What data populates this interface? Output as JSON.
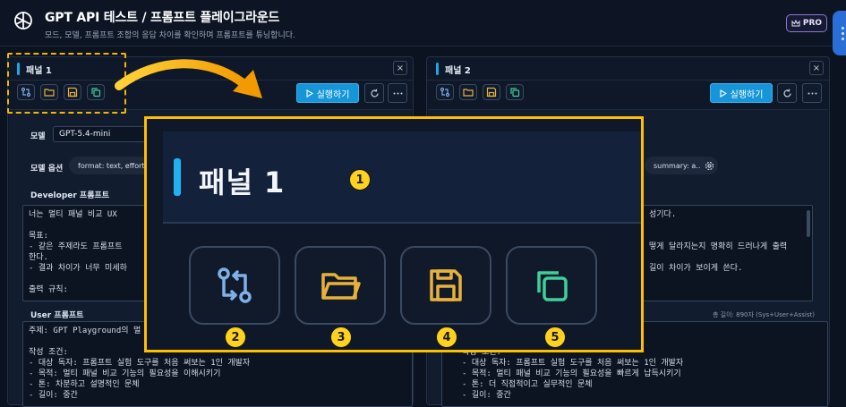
{
  "app": {
    "title": "GPT API 테스트 / 프롬프트 플레이그라운드",
    "subtitle": "모드, 모델, 프롬프트 조합의 응답 차이를 확인하며 프롬프트를 튜닝합니다.",
    "pro_label": "PRO"
  },
  "panels": [
    {
      "title": "패널 1",
      "run_label": "실행하기",
      "close": "×",
      "model_label": "모델",
      "model_value": "GPT-5.4-mini",
      "options_label": "모델 옵션",
      "options_value": "format: text, effort:",
      "developer_label": "Developer 프롬프트",
      "developer_text": "너는 멀티 패널 비교 UX\n\n목표:\n- 같은 주제라도 프롬프트\n한다.\n- 결과 차이가 너무 미세하\n\n출력 규칙:",
      "user_label": "User 프롬프트",
      "user_text": "주제: GPT Playground의 멀\n\n작성 조건:\n- 대상 독자: 프롬프트 실험 도구를 처음 써보는 1인 개발자\n- 목적: 멀티 패널 비교 기능의 필요성을 이해시키기\n- 톤: 차분하고 설명적인 문체\n- 길이: 중간"
    },
    {
      "title": "패널 2",
      "run_label": "실행하기",
      "close": "×",
      "options_value": "summary: a…",
      "developer_text": "성기다.\n\n\n떻게 달라지는지 명확히 드러나게 출력\n\n길이 차이가 보이게 쓴다.",
      "length_meta": "총 길이: 890자 (Sys+User+Assist)",
      "user_text": "왜 필요한가\n\n작성 조건:\n- 대상 독자: 프롬프트 실험 도구를 처음 써보는 1인 개발자\n- 목적: 멀티 패널 비교 기능의 필요성을 빠르게 납득시키기\n- 톤: 더 직접적이고 실무적인 문체\n- 길이: 중간"
    }
  ],
  "zoom": {
    "title": "패널 1",
    "badges": [
      "1",
      "2",
      "3",
      "4",
      "5"
    ]
  },
  "colors": {
    "accent": "#1696d8",
    "highlight": "#ffbf00",
    "badge": "#ffd21f",
    "folder": "#e8b23a",
    "copy": "#3fcf9a",
    "swap": "#7fb0e8"
  },
  "icons": [
    "swap-icon",
    "folder-icon",
    "save-icon",
    "copy-icon",
    "play-icon",
    "refresh-icon",
    "more-icon",
    "close-icon",
    "gear-icon",
    "crown-icon"
  ]
}
